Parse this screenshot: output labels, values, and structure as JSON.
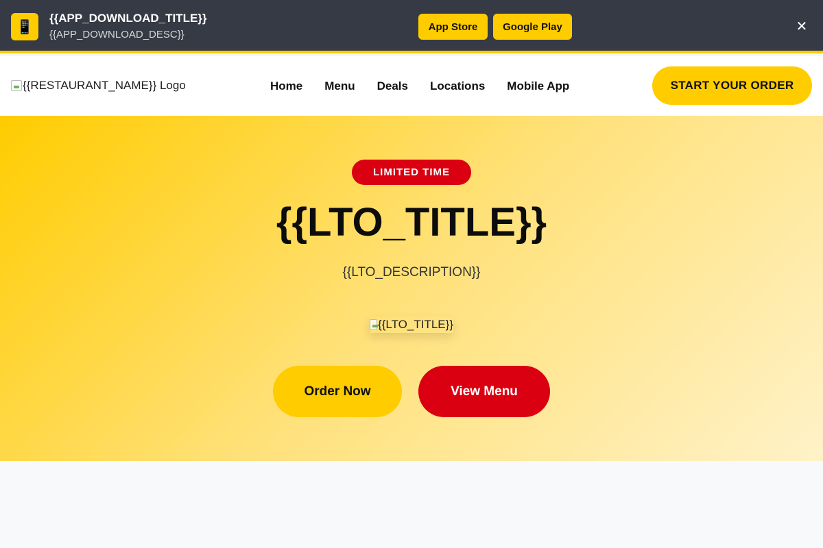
{
  "app_banner": {
    "icon": "📱",
    "title": "{{APP_DOWNLOAD_TITLE}}",
    "description": "{{APP_DOWNLOAD_DESC}}",
    "app_store_label": "App Store",
    "google_play_label": "Google Play",
    "close_label": "✕"
  },
  "header": {
    "logo_alt": "{{RESTAURANT_NAME}} Logo",
    "nav": [
      {
        "label": "Home"
      },
      {
        "label": "Menu"
      },
      {
        "label": "Deals"
      },
      {
        "label": "Locations"
      },
      {
        "label": "Mobile App"
      }
    ],
    "cta_label": "START YOUR ORDER"
  },
  "hero": {
    "badge": "LIMITED TIME",
    "title": "{{LTO_TITLE}}",
    "description": "{{LTO_DESCRIPTION}}",
    "image_alt": "{{LTO_TITLE}}",
    "order_label": "Order Now",
    "view_menu_label": "View Menu"
  },
  "colors": {
    "accent_yellow": "#ffcc00",
    "accent_red": "#da0011",
    "banner_bg": "#363a44"
  }
}
